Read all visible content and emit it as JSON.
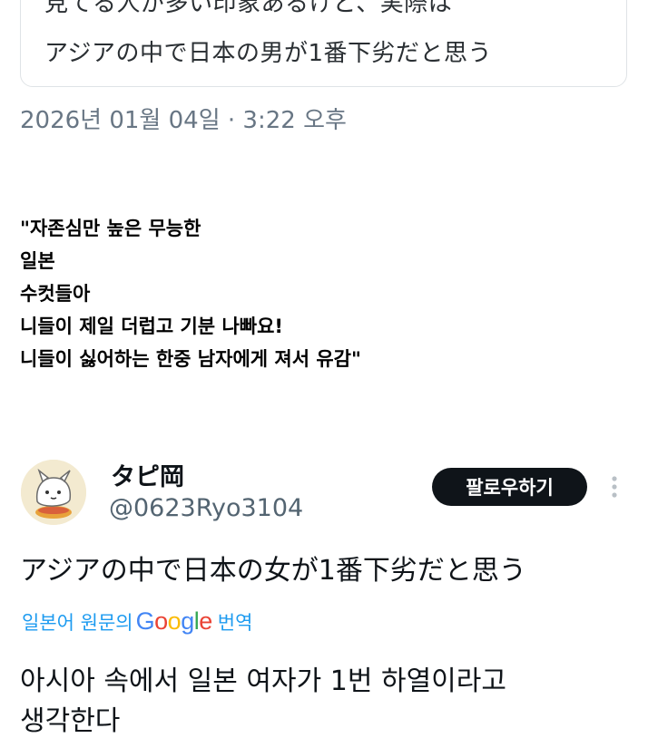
{
  "quoted_tweet": {
    "lines": [
      "見てる人が多い印象あるけど、実際は",
      "アジアの中で日本の男が1番下劣だと思う"
    ]
  },
  "timestamp": "2026년 01월 04일 · 3:22 오후",
  "comment": {
    "lines": [
      "\"자존심만 높은 무능한",
      "일본",
      "수컷들아",
      "니들이 제일 더럽고 기분 나빠요!",
      "니들이 싫어하는 한중 남자에게 져서 유감\""
    ]
  },
  "tweet": {
    "display_name": "タピ岡",
    "handle": "@0623Ryo3104",
    "follow_label": "팔로우하기",
    "text": "アジアの中で日本の女が1番下劣だと思う",
    "translation_prefix": "일본어 원문의",
    "translation_brand": "Google",
    "translation_suffix": "번역",
    "translated_lines": [
      "아시아 속에서 일본 여자가 1번 하열이라고",
      "생각한다"
    ]
  },
  "colors": {
    "link_blue": "#1d9bf0",
    "secondary_text": "#536471",
    "follow_button_bg": "#0f1419"
  }
}
